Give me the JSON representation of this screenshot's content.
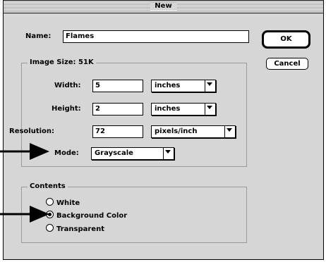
{
  "dialog": {
    "title": "New",
    "name_label": "Name:",
    "name_value": "Flames",
    "image_size_label": "Image Size: 51K",
    "width": {
      "label": "Width:",
      "value": "5",
      "unit": "inches"
    },
    "height": {
      "label": "Height:",
      "value": "2",
      "unit": "inches"
    },
    "resolution": {
      "label": "Resolution:",
      "value": "72",
      "unit": "pixels/inch"
    },
    "mode": {
      "label": "Mode:",
      "value": "Grayscale"
    },
    "contents": {
      "label": "Contents",
      "options": [
        {
          "label": "White",
          "selected": false
        },
        {
          "label": "Background Color",
          "selected": true
        },
        {
          "label": "Transparent",
          "selected": false
        }
      ]
    },
    "ok_label": "OK",
    "cancel_label": "Cancel"
  }
}
